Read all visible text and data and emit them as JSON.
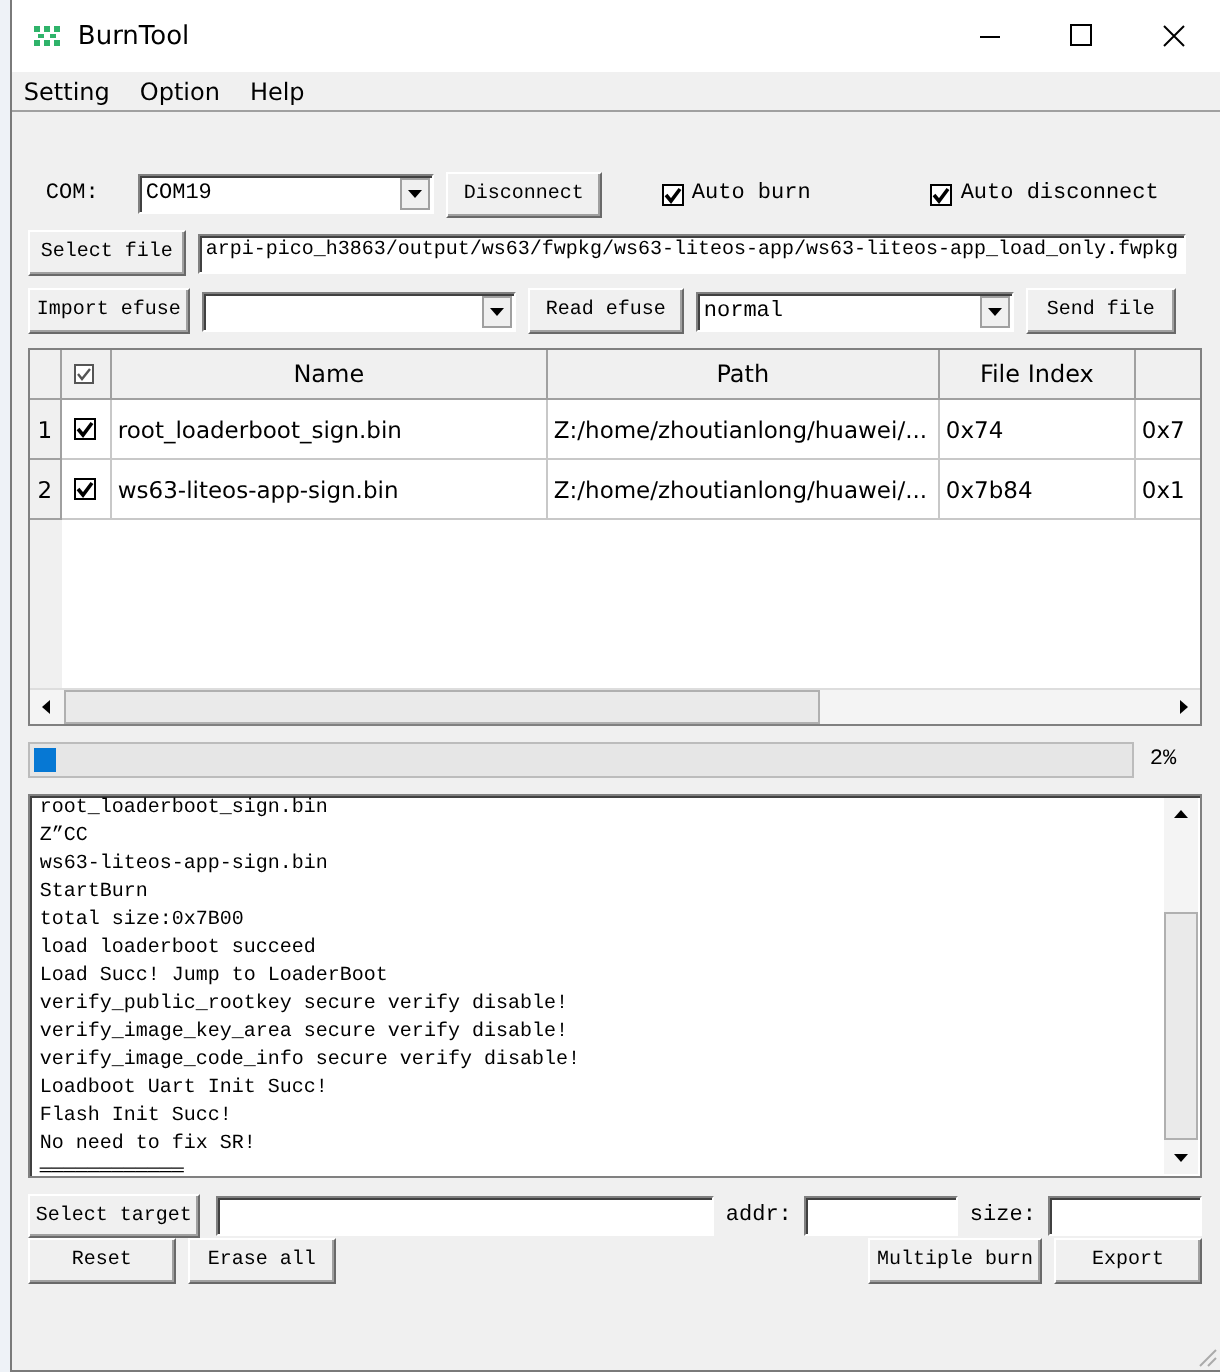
{
  "window": {
    "title": "BurnTool"
  },
  "menu": [
    {
      "label": "Setting"
    },
    {
      "label": "Option"
    },
    {
      "label": "Help"
    }
  ],
  "connection": {
    "label": "COM:",
    "port": "COM19",
    "button": "Disconnect"
  },
  "checkboxes": [
    {
      "label": "Auto burn",
      "checked": true
    },
    {
      "label": "Auto disconnect",
      "checked": true
    }
  ],
  "file": {
    "button": "Select file",
    "value": "arpi-pico_h3863/output/ws63/fwpkg/ws63-liteos-app/ws63-liteos-app_load_only.fwpkg"
  },
  "efuse": {
    "import_button": "Import efuse",
    "read_button": "Read efuse",
    "mode": "normal",
    "send_button": "Send file"
  },
  "table": {
    "columns": [
      "Name",
      "Path",
      "File Index"
    ],
    "rows": [
      {
        "index": "1",
        "checked": true,
        "cells": [
          "root_loaderboot_sign.bin",
          "Z:/home/zhoutianlong/huawei/...",
          "0x74",
          "0x7"
        ]
      },
      {
        "index": "2",
        "checked": true,
        "cells": [
          "ws63-liteos-app-sign.bin",
          "Z:/home/zhoutianlong/huawei/...",
          "0x7b84",
          "0x1"
        ]
      }
    ]
  },
  "progress": {
    "level": 0.02,
    "reading": "2%"
  },
  "log": [
    "root_loaderboot_sign.bin",
    "Z”CC",
    "ws63-liteos-app-sign.bin",
    "StartBurn",
    "total size:0x7B00",
    "load loaderboot succeed",
    "Load Succ! Jump to LoaderBoot",
    "verify_public_rootkey secure verify disable!",
    "verify_image_key_area secure verify disable!",
    "verify_image_code_info secure verify disable!",
    "Loadboot Uart Init Succ!",
    "Flash Init Succ!",
    "No need to fix SR!",
    "════════════"
  ],
  "target": {
    "button": "Select target",
    "addr_label": "addr:",
    "size_label": "size:"
  },
  "actions": {
    "left": [
      "Reset",
      "Erase all"
    ],
    "right": [
      "Multiple burn",
      "Export"
    ]
  }
}
